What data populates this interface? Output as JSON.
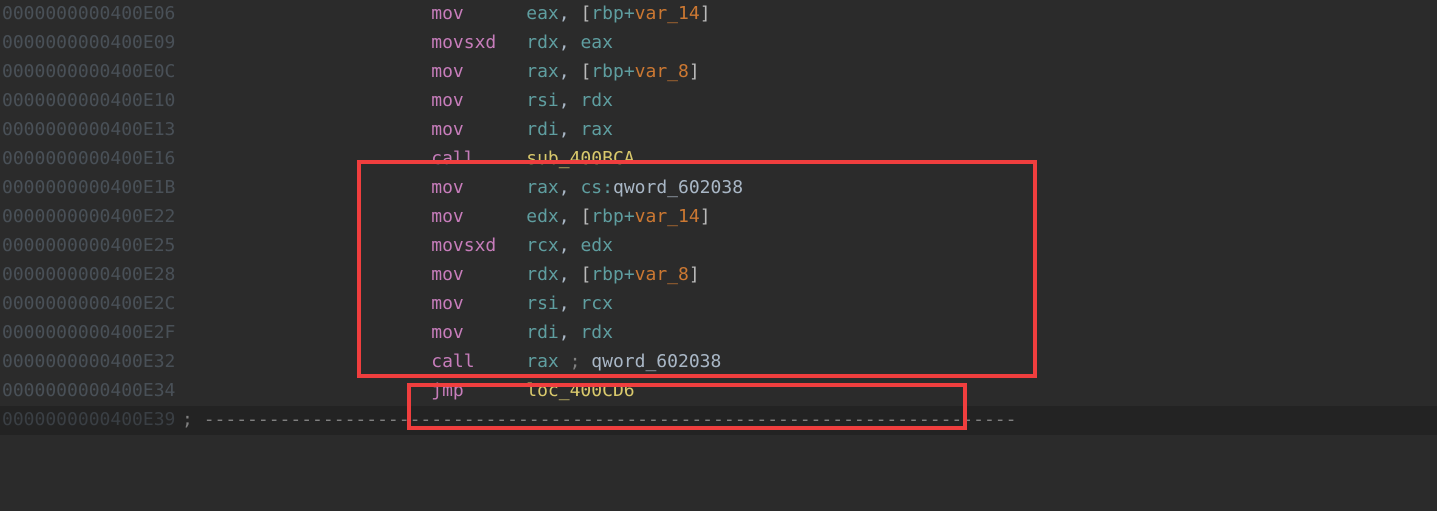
{
  "lines": [
    {
      "addr": "0000000000400E06",
      "mnemonic": "mov",
      "op": [
        {
          "t": "reg",
          "v": "eax"
        },
        {
          "t": "comma",
          "v": ", "
        },
        {
          "t": "bracket",
          "v": "["
        },
        {
          "t": "reg",
          "v": "rbp"
        },
        {
          "t": "plus",
          "v": "+"
        },
        {
          "t": "var",
          "v": "var_14"
        },
        {
          "t": "bracket",
          "v": "]"
        }
      ]
    },
    {
      "addr": "0000000000400E09",
      "mnemonic": "movsxd",
      "op": [
        {
          "t": "reg",
          "v": "rdx"
        },
        {
          "t": "comma",
          "v": ", "
        },
        {
          "t": "reg",
          "v": "eax"
        }
      ]
    },
    {
      "addr": "0000000000400E0C",
      "mnemonic": "mov",
      "op": [
        {
          "t": "reg",
          "v": "rax"
        },
        {
          "t": "comma",
          "v": ", "
        },
        {
          "t": "bracket",
          "v": "["
        },
        {
          "t": "reg",
          "v": "rbp"
        },
        {
          "t": "plus",
          "v": "+"
        },
        {
          "t": "var",
          "v": "var_8"
        },
        {
          "t": "bracket",
          "v": "]"
        }
      ]
    },
    {
      "addr": "0000000000400E10",
      "mnemonic": "mov",
      "op": [
        {
          "t": "reg",
          "v": "rsi"
        },
        {
          "t": "comma",
          "v": ", "
        },
        {
          "t": "reg",
          "v": "rdx"
        }
      ]
    },
    {
      "addr": "0000000000400E13",
      "mnemonic": "mov",
      "op": [
        {
          "t": "reg",
          "v": "rdi"
        },
        {
          "t": "comma",
          "v": ", "
        },
        {
          "t": "reg",
          "v": "rax"
        }
      ]
    },
    {
      "addr": "0000000000400E16",
      "mnemonic": "call",
      "op": [
        {
          "t": "sub",
          "v": "sub_400BCA"
        }
      ]
    },
    {
      "addr": "0000000000400E1B",
      "mnemonic": "mov",
      "op": [
        {
          "t": "reg",
          "v": "rax"
        },
        {
          "t": "comma",
          "v": ", "
        },
        {
          "t": "cs",
          "v": "cs"
        },
        {
          "t": "colon",
          "v": ":"
        },
        {
          "t": "qword",
          "v": "qword_602038"
        }
      ]
    },
    {
      "addr": "0000000000400E22",
      "mnemonic": "mov",
      "op": [
        {
          "t": "reg",
          "v": "edx"
        },
        {
          "t": "comma",
          "v": ", "
        },
        {
          "t": "bracket",
          "v": "["
        },
        {
          "t": "reg",
          "v": "rbp"
        },
        {
          "t": "plus",
          "v": "+"
        },
        {
          "t": "var",
          "v": "var_14"
        },
        {
          "t": "bracket",
          "v": "]"
        }
      ]
    },
    {
      "addr": "0000000000400E25",
      "mnemonic": "movsxd",
      "op": [
        {
          "t": "reg",
          "v": "rcx"
        },
        {
          "t": "comma",
          "v": ", "
        },
        {
          "t": "reg",
          "v": "edx"
        }
      ]
    },
    {
      "addr": "0000000000400E28",
      "mnemonic": "mov",
      "op": [
        {
          "t": "reg",
          "v": "rdx"
        },
        {
          "t": "comma",
          "v": ", "
        },
        {
          "t": "bracket",
          "v": "["
        },
        {
          "t": "reg",
          "v": "rbp"
        },
        {
          "t": "plus",
          "v": "+"
        },
        {
          "t": "var",
          "v": "var_8"
        },
        {
          "t": "bracket",
          "v": "]"
        }
      ]
    },
    {
      "addr": "0000000000400E2C",
      "mnemonic": "mov",
      "op": [
        {
          "t": "reg",
          "v": "rsi"
        },
        {
          "t": "comma",
          "v": ", "
        },
        {
          "t": "reg",
          "v": "rcx"
        }
      ]
    },
    {
      "addr": "0000000000400E2F",
      "mnemonic": "mov",
      "op": [
        {
          "t": "reg",
          "v": "rdi"
        },
        {
          "t": "comma",
          "v": ", "
        },
        {
          "t": "reg",
          "v": "rdx"
        }
      ]
    },
    {
      "addr": "0000000000400E32",
      "mnemonic": "call",
      "op": [
        {
          "t": "reg",
          "v": "rax"
        },
        {
          "t": "comment",
          "v": " ; "
        },
        {
          "t": "qword",
          "v": "qword_602038"
        }
      ]
    },
    {
      "addr": "0000000000400E34",
      "mnemonic": "jmp",
      "op": [
        {
          "t": "sub",
          "v": "loc_400CD6"
        }
      ]
    }
  ],
  "separator": {
    "addr": "0000000000400E39",
    "prefix": "; ",
    "dashes": "---------------------------------------------------------------------------"
  },
  "indent": "                       "
}
